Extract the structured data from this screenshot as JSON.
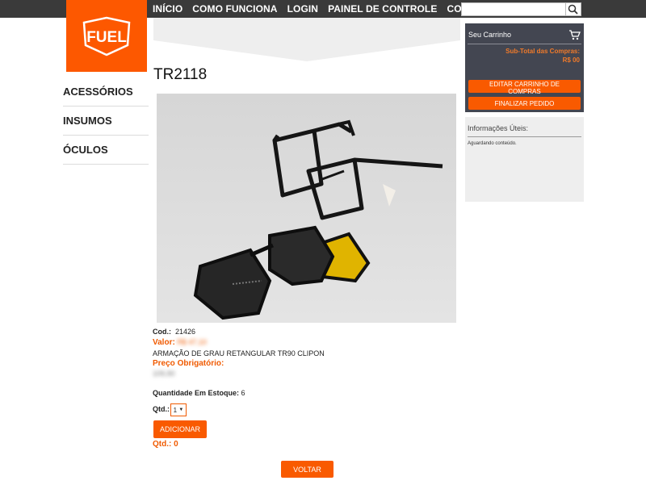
{
  "nav": {
    "items": [
      "INÍCIO",
      "COMO FUNCIONA",
      "LOGIN",
      "PAINEL DE CONTROLE",
      "CONTATO"
    ]
  },
  "search": {
    "placeholder": "",
    "value": ""
  },
  "logo": {
    "text": "FUEL",
    "color": "#fd5800"
  },
  "sidebar": {
    "items": [
      {
        "label": "ACESSÓRIOS"
      },
      {
        "label": "INSUMOS"
      },
      {
        "label": "ÓCULOS"
      }
    ]
  },
  "product": {
    "title": "TR2118",
    "cod_label": "Cod.:",
    "cod_value": "21426",
    "valor_label": "Valor:",
    "valor_value": "R$ 47,10",
    "description": "ARMAÇÃO DE GRAU RETANGULAR TR90 CLIPON",
    "preco_label": "Preço Obrigatório:",
    "preco_value": "109,90",
    "estoque_label": "Quantidade Em Estoque:",
    "estoque_value": "6",
    "qtd_label": "Qtd.:",
    "qtd_selected": "1",
    "add_label": "ADICIONAR",
    "qtd_total": "Qtd.: 0",
    "back_label": "VOLTAR"
  },
  "cart": {
    "title": "Seu Carrinho",
    "subtotal_label": "Sub-Total das Compras:",
    "subtotal_value": "R$ 00",
    "edit_label": "EDITAR CARRINHO DE COMPRAS",
    "finish_label": "FINALIZAR PEDIDO"
  },
  "info_panel": {
    "title": "Informações Úteis:",
    "content": "Aguardando conteúdo."
  },
  "colors": {
    "accent": "#f95a00",
    "nav_bg": "#3a3a3a",
    "cart_bg": "#434651"
  }
}
